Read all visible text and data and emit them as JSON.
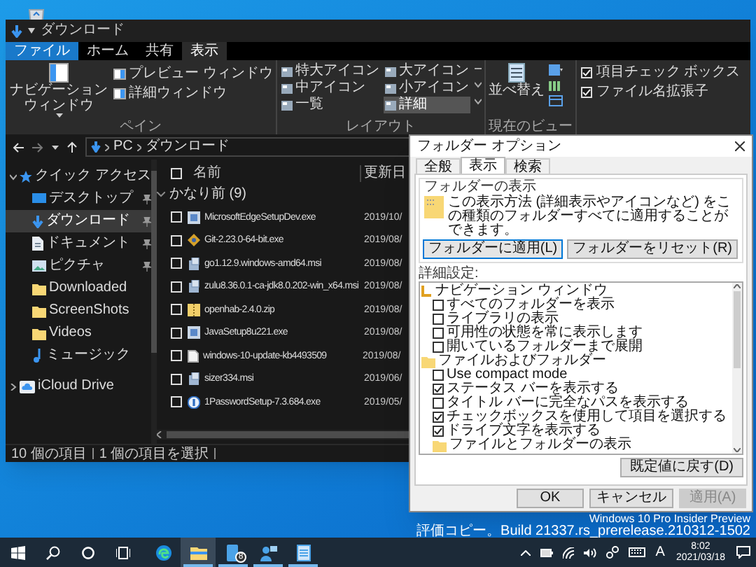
{
  "explorer": {
    "title": "ダウンロード",
    "tabs": [
      {
        "label": "ファイル",
        "kind": "file",
        "selected": false
      },
      {
        "label": "ホーム",
        "kind": "tab",
        "selected": false
      },
      {
        "label": "共有",
        "kind": "tab",
        "selected": false
      },
      {
        "label": "表示",
        "kind": "tab",
        "selected": true
      }
    ],
    "ribbon": {
      "pane": {
        "navigation_pane": "ナビゲーションウィンドウ",
        "preview_pane": "プレビュー ウィンドウ",
        "details_pane": "詳細ウィンドウ",
        "label": "ペイン"
      },
      "layout": {
        "label": "レイアウト",
        "options": [
          {
            "label": "特大アイコン",
            "selected": false
          },
          {
            "label": "大アイコン",
            "selected": false
          },
          {
            "label": "中アイコン",
            "selected": false
          },
          {
            "label": "小アイコン",
            "selected": false
          },
          {
            "label": "一覧",
            "selected": false
          },
          {
            "label": "詳細",
            "selected": true
          }
        ]
      },
      "current_view": {
        "sort": "並べ替え",
        "label": "現在のビュー"
      },
      "show_hide": [
        {
          "label": "項目チェック ボックス",
          "checked": true
        },
        {
          "label": "ファイル名拡張子",
          "checked": true
        }
      ]
    },
    "address": {
      "path": [
        "PC",
        "ダウンロード"
      ]
    },
    "sidebar": [
      {
        "label": "クイック アクセス",
        "kind": "star",
        "expanded": true,
        "selected": false,
        "children": [
          {
            "label": "デスクトップ",
            "kind": "desktop",
            "pinned": true,
            "selected": false
          },
          {
            "label": "ダウンロード",
            "kind": "download",
            "pinned": true,
            "selected": true
          },
          {
            "label": "ドキュメント",
            "kind": "document",
            "pinned": true,
            "selected": false
          },
          {
            "label": "ピクチャ",
            "kind": "picture",
            "pinned": true,
            "selected": false
          },
          {
            "label": "Downloaded",
            "kind": "folder",
            "pinned": false,
            "selected": false
          },
          {
            "label": "ScreenShots",
            "kind": "folder",
            "pinned": false,
            "selected": false
          },
          {
            "label": "Videos",
            "kind": "folder",
            "pinned": false,
            "selected": false
          },
          {
            "label": "ミュージック",
            "kind": "music",
            "pinned": false,
            "selected": false
          }
        ]
      },
      {
        "label": "iCloud Drive",
        "kind": "cloud",
        "expanded": false,
        "selected": false
      }
    ],
    "file_list": {
      "columns": [
        "名前",
        "更新日"
      ],
      "select_all_checked": false,
      "groups": [
        {
          "label": "かなり前 (9)",
          "expanded": true,
          "rows": [
            {
              "name": "MicrosoftEdgeSetupDev.exe",
              "date": "2019/10/",
              "kind": "setup",
              "checked": false
            },
            {
              "name": "Git-2.23.0-64-bit.exe",
              "date": "2019/08/",
              "kind": "git",
              "checked": false
            },
            {
              "name": "go1.12.9.windows-amd64.msi",
              "date": "2019/08/",
              "kind": "msi",
              "checked": false
            },
            {
              "name": "zulu8.36.0.1-ca-jdk8.0.202-win_x64.msi",
              "date": "2019/08/",
              "kind": "msi",
              "checked": false
            },
            {
              "name": "openhab-2.4.0.zip",
              "date": "2019/08/",
              "kind": "zip",
              "checked": false
            },
            {
              "name": "JavaSetup8u221.exe",
              "date": "2019/08/",
              "kind": "setup",
              "checked": false
            },
            {
              "name": "windows-10-update-kb4493509",
              "date": "2019/08/",
              "kind": "file",
              "checked": false
            },
            {
              "name": "sizer334.msi",
              "date": "2019/06/",
              "kind": "msi",
              "checked": false
            },
            {
              "name": "1PasswordSetup-7.3.684.exe",
              "date": "2019/05/",
              "kind": "onepass",
              "checked": false
            }
          ]
        }
      ]
    },
    "status_bar": [
      "10 個の項目",
      "1 個の項目を選択"
    ]
  },
  "dialog": {
    "title": "フォルダー オプション",
    "tabs": [
      {
        "label": "全般",
        "selected": false
      },
      {
        "label": "表示",
        "selected": true
      },
      {
        "label": "検索",
        "selected": false
      }
    ],
    "folder_views": {
      "legend": "フォルダーの表示",
      "description": "この表示方法 (詳細表示やアイコンなど) をこの種類のフォルダーすべてに適用することができます。",
      "buttons": [
        "フォルダーに適用(L)",
        "フォルダーをリセット(R)"
      ]
    },
    "advanced": {
      "label": "詳細設定:",
      "tree": [
        {
          "label": "ナビゲーション ウィンドウ",
          "kind": "navigation",
          "children": [
            {
              "label": "すべてのフォルダーを表示",
              "kind": "checkbox",
              "checked": false
            },
            {
              "label": "ライブラリの表示",
              "kind": "checkbox",
              "checked": false
            },
            {
              "label": "可用性の状態を常に表示します",
              "kind": "checkbox",
              "checked": false
            },
            {
              "label": "開いているフォルダーまで展開",
              "kind": "checkbox",
              "checked": false
            }
          ]
        },
        {
          "label": "ファイルおよびフォルダー",
          "kind": "folder",
          "children": [
            {
              "label": "Use compact mode",
              "kind": "checkbox",
              "checked": false
            },
            {
              "label": "ステータス バーを表示する",
              "kind": "checkbox",
              "checked": true
            },
            {
              "label": "タイトル バーに完全なパスを表示する",
              "kind": "checkbox",
              "checked": false
            },
            {
              "label": "チェックボックスを使用して項目を選択する",
              "kind": "checkbox",
              "checked": true
            },
            {
              "label": "ドライブ文字を表示する",
              "kind": "checkbox",
              "checked": true
            },
            {
              "label": "ファイルとフォルダーの表示",
              "kind": "folder"
            }
          ]
        }
      ]
    },
    "restore_button": "既定値に戻す(D)",
    "buttons": [
      {
        "label": "OK",
        "disabled": false
      },
      {
        "label": "キャンセル",
        "disabled": false
      },
      {
        "label": "適用(A)",
        "disabled": true
      }
    ]
  },
  "watermark": [
    "Windows 10 Pro Insider Preview",
    "評価コピー。Build 21337.rs_prerelease.210312-1502"
  ],
  "taskbar": {
    "apps": [
      {
        "kind": "edge",
        "running": false,
        "active": false
      },
      {
        "kind": "explorer",
        "running": true,
        "active": true
      },
      {
        "kind": "tablet",
        "running": true,
        "active": false,
        "badge": "8"
      },
      {
        "kind": "people",
        "running": true,
        "active": false
      },
      {
        "kind": "notepad",
        "running": true,
        "active": false
      }
    ],
    "ime": "A",
    "time": "8:02",
    "date": "2021/03/18"
  }
}
